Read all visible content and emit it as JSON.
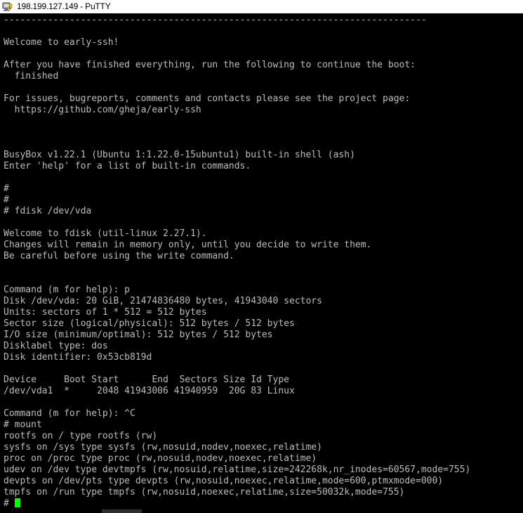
{
  "window": {
    "title": "198.199.127.149 - PuTTY",
    "icon": "putty-icon",
    "host": "198.199.127.149",
    "app": "PuTTY"
  },
  "theme": {
    "background": "#000000",
    "foreground": "#bbbbbb",
    "cursor": "#00ff00",
    "titlebar_background": "#ffffff",
    "titlebar_foreground": "#000000"
  },
  "terminal": {
    "cursor_visible": true,
    "cursor_shape": "block",
    "columns": 92,
    "rows": 44,
    "lines": [
      "-----------------------------------------------------------------------------",
      "",
      "Welcome to early-ssh!",
      "",
      "After you have finished everything, run the following to continue the boot:",
      "  finished",
      "",
      "For issues, bugreports, comments and contacts please see the project page:",
      "  https://github.com/gheja/early-ssh",
      "",
      "",
      "",
      "BusyBox v1.22.1 (Ubuntu 1:1.22.0-15ubuntu1) built-in shell (ash)",
      "Enter 'help' for a list of built-in commands.",
      "",
      "#",
      "#",
      "# fdisk /dev/vda",
      "",
      "Welcome to fdisk (util-linux 2.27.1).",
      "Changes will remain in memory only, until you decide to write them.",
      "Be careful before using the write command.",
      "",
      "",
      "Command (m for help): p",
      "Disk /dev/vda: 20 GiB, 21474836480 bytes, 41943040 sectors",
      "Units: sectors of 1 * 512 = 512 bytes",
      "Sector size (logical/physical): 512 bytes / 512 bytes",
      "I/O size (minimum/optimal): 512 bytes / 512 bytes",
      "Disklabel type: dos",
      "Disk identifier: 0x53cb819d",
      "",
      "Device     Boot Start      End  Sectors Size Id Type",
      "/dev/vda1  *     2048 41943006 41940959  20G 83 Linux",
      "",
      "Command (m for help): ^C",
      "# mount",
      "rootfs on / type rootfs (rw)",
      "sysfs on /sys type sysfs (rw,nosuid,nodev,noexec,relatime)",
      "proc on /proc type proc (rw,nosuid,nodev,noexec,relatime)",
      "udev on /dev type devtmpfs (rw,nosuid,relatime,size=242268k,nr_inodes=60567,mode=755)",
      "devpts on /dev/pts type devpts (rw,nosuid,noexec,relatime,mode=600,ptmxmode=000)",
      "tmpfs on /run type tmpfs (rw,nosuid,noexec,relatime,size=50032k,mode=755)"
    ],
    "prompt": "# "
  }
}
